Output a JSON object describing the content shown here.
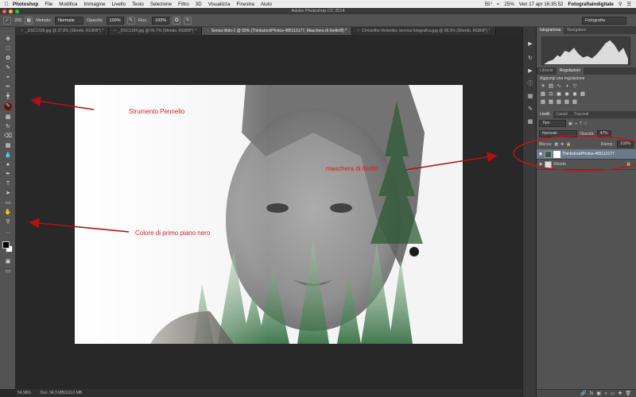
{
  "menubar": {
    "app": "Photoshop",
    "items": [
      "File",
      "Modifica",
      "Immagine",
      "Livello",
      "Testo",
      "Selezione",
      "Filtro",
      "3D",
      "Visualizza",
      "Finestra",
      "Aiuto"
    ],
    "temp": "55°",
    "battery": "25%",
    "datetime": "Ven 17 apr  16:35:52",
    "user": "Fotografiaindigitale"
  },
  "window": {
    "title": "Adobe Photoshop CC 2014"
  },
  "options": {
    "brush_size": "200",
    "mode_label": "Metodo:",
    "mode_value": "Normale",
    "opacity_label": "Opacità:",
    "opacity_value": "100%",
    "flow_label": "Flus.:",
    "flow_value": "100%",
    "workspace": "Fotografia"
  },
  "tabs": [
    {
      "label": "_DSC1328.jpg @ 37,8% (Sfondo, RGB/8*) *",
      "active": false
    },
    {
      "label": "_DSC1194.jpg @ 66,7% (Sfondo, RGB/8*) *",
      "active": false
    },
    {
      "label": "Senza titolo-1 @ 55% (ThinkstockPhotos-485113177, Maschera di livello/8) *",
      "active": true
    },
    {
      "label": "Christoffer Relander, tecnica fotografica.jpg @ 68,3% (Sfondo, RGB/8*) *",
      "active": false
    }
  ],
  "panels": {
    "top_tabs": [
      "Istogramma",
      "Navigatore"
    ],
    "mid_tabs": [
      "Librerie",
      "Regolazioni"
    ],
    "adjust_title": "Aggiungi una regolazione",
    "layer_tabs": [
      "Livelli",
      "Canali",
      "Tracciati"
    ],
    "kind_label": "Tipo",
    "blend": "Normale",
    "opacity_label": "Opacità:",
    "opacity": "47%",
    "lock_label": "Blocca:",
    "fill_label": "Riemp.:",
    "fill": "100%",
    "layers": [
      {
        "name": "ThinkstockPhotos-485113177",
        "selected": true
      },
      {
        "name": "Sfondo",
        "selected": false
      }
    ]
  },
  "status": {
    "zoom": "54,96%",
    "doc": "Doc: 34,3 MB/110,0 MB"
  },
  "annotations": {
    "brush_tool": "Strumento Pennello",
    "layer_mask": "maschera di livello",
    "fg_color": "Colore di primo piano nero"
  },
  "colors": {
    "annotation": "#d42020",
    "selected_layer": "#6b7a8c",
    "panel_bg": "#535353"
  }
}
